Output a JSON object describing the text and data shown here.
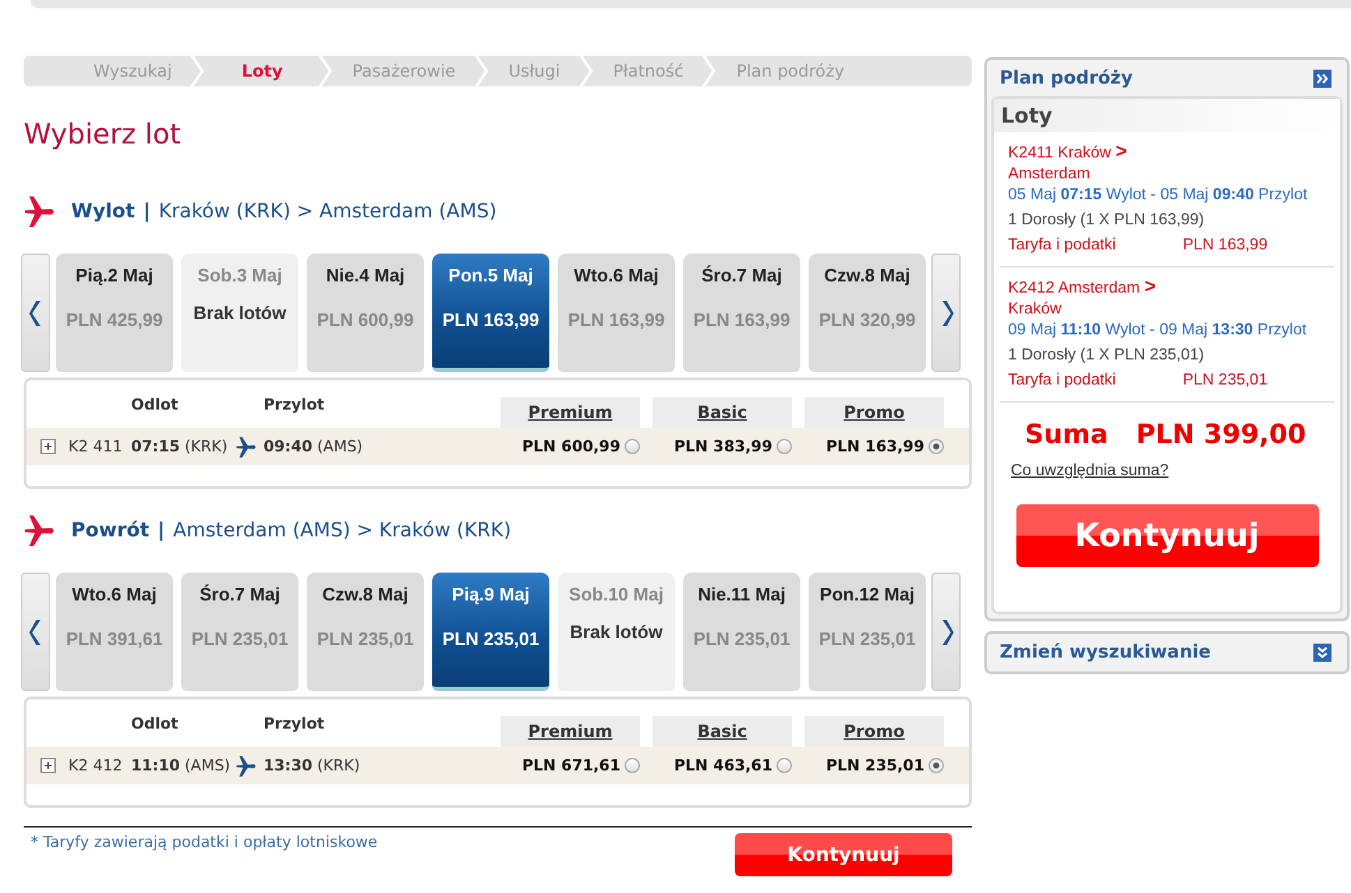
{
  "steps": [
    {
      "label": "Wyszukaj",
      "selected": false
    },
    {
      "label": "Loty",
      "selected": true
    },
    {
      "label": "Pasażerowie",
      "selected": false
    },
    {
      "label": "Usługi",
      "selected": false
    },
    {
      "label": "Płatność",
      "selected": false
    },
    {
      "label": "Plan podróży",
      "selected": false
    }
  ],
  "title": "Wybierz lot",
  "sections": [
    {
      "direction": "Wylot",
      "separator": "|",
      "route": "Kraków (KRK) > Amsterdam (AMS)",
      "days": [
        {
          "kind": "fare",
          "date": "Pią.2 Maj",
          "price": "PLN 425,99",
          "selected": false
        },
        {
          "kind": "no_flights",
          "date": "Sob.3 Maj",
          "note": "Brak lotów",
          "selected": false
        },
        {
          "kind": "fare",
          "date": "Nie.4 Maj",
          "price": "PLN 600,99",
          "selected": false
        },
        {
          "kind": "fare",
          "date": "Pon.5 Maj",
          "price": "PLN 163,99",
          "selected": true
        },
        {
          "kind": "fare",
          "date": "Wto.6 Maj",
          "price": "PLN 163,99",
          "selected": false
        },
        {
          "kind": "fare",
          "date": "Śro.7 Maj",
          "price": "PLN 163,99",
          "selected": false
        },
        {
          "kind": "fare",
          "date": "Czw.8 Maj",
          "price": "PLN 320,99",
          "selected": false
        }
      ],
      "columns": [
        "Odlot",
        "Przylot"
      ],
      "fare_columns": [
        "Premium",
        "Basic",
        "Promo"
      ],
      "rows": [
        {
          "flight": "K2 411",
          "depart_time": "07:15",
          "depart_airport": "(KRK)",
          "arrive_time": "09:40",
          "arrive_airport": "(AMS)",
          "fares": [
            {
              "price": "PLN 600,99",
              "selected": false
            },
            {
              "price": "PLN 383,99",
              "selected": false
            },
            {
              "price": "PLN 163,99",
              "selected": true
            }
          ]
        }
      ]
    },
    {
      "direction": "Powrót",
      "separator": "|",
      "route": "Amsterdam (AMS) > Kraków (KRK)",
      "days": [
        {
          "kind": "fare",
          "date": "Wto.6 Maj",
          "price": "PLN 391,61",
          "selected": false
        },
        {
          "kind": "fare",
          "date": "Śro.7 Maj",
          "price": "PLN 235,01",
          "selected": false
        },
        {
          "kind": "fare",
          "date": "Czw.8 Maj",
          "price": "PLN 235,01",
          "selected": false
        },
        {
          "kind": "fare",
          "date": "Pią.9 Maj",
          "price": "PLN 235,01",
          "selected": true
        },
        {
          "kind": "no_flights",
          "date": "Sob.10 Maj",
          "note": "Brak lotów",
          "selected": false
        },
        {
          "kind": "fare",
          "date": "Nie.11 Maj",
          "price": "PLN 235,01",
          "selected": false
        },
        {
          "kind": "fare",
          "date": "Pon.12 Maj",
          "price": "PLN 235,01",
          "selected": false
        }
      ],
      "columns": [
        "Odlot",
        "Przylot"
      ],
      "fare_columns": [
        "Premium",
        "Basic",
        "Promo"
      ],
      "rows": [
        {
          "flight": "K2 412",
          "depart_time": "11:10",
          "depart_airport": "(AMS)",
          "arrive_time": "13:30",
          "arrive_airport": "(KRK)",
          "fares": [
            {
              "price": "PLN 671,61",
              "selected": false
            },
            {
              "price": "PLN 463,61",
              "selected": false
            },
            {
              "price": "PLN 235,01",
              "selected": true
            }
          ]
        }
      ]
    }
  ],
  "footnote": "* Taryfy zawierają podatki i opłaty lotniskowe",
  "continue_button": "Kontynuuj",
  "sidebar": {
    "title": "Plan podróży",
    "flights_heading": "Loty",
    "flights": [
      {
        "route": "K2411 Kraków **>** Amsterdam",
        "times": "05 Maj **07:15** Wylot - 05 Maj **09:40** Przylot",
        "passengers": "1 Dorosły (1 X PLN 163,99)",
        "fare_label": "Taryfa i podatki",
        "fare_amount": "PLN 163,99"
      },
      {
        "route": "K2412 Amsterdam **>** Kraków",
        "times": "09 Maj **11:10** Wylot - 09 Maj **13:30** Przylot",
        "passengers": "1 Dorosły (1 X PLN 235,01)",
        "fare_label": "Taryfa i podatki",
        "fare_amount": "PLN 235,01"
      }
    ],
    "total_label": "Suma",
    "total_amount": "PLN 399,00",
    "total_link": "Co uwzględnia suma?",
    "button": "Kontynuuj",
    "change_search": "Zmień wyszukiwanie"
  }
}
